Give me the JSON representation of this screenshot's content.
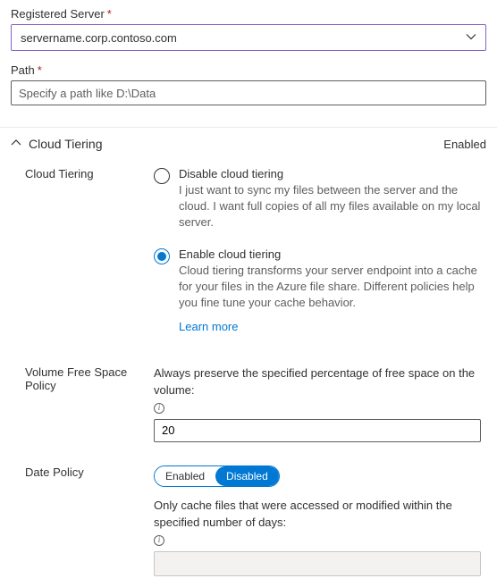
{
  "registeredServer": {
    "label": "Registered Server",
    "required": "*",
    "value": "servername.corp.contoso.com"
  },
  "path": {
    "label": "Path",
    "required": "*",
    "placeholder": "Specify a path like D:\\Data"
  },
  "section": {
    "title": "Cloud Tiering",
    "status": "Enabled"
  },
  "cloudTiering": {
    "label": "Cloud Tiering",
    "disableOption": {
      "title": "Disable cloud tiering",
      "desc": "I just want to sync my files between the server and the cloud. I want full copies of all my files available on my local server."
    },
    "enableOption": {
      "title": "Enable cloud tiering",
      "desc": "Cloud tiering transforms your server endpoint into a cache for your files in the Azure file share. Different policies help you fine tune your cache behavior."
    },
    "learnMore": "Learn more"
  },
  "volumePolicy": {
    "label": "Volume Free Space Policy",
    "desc": "Always preserve the specified percentage of free space on the volume:",
    "value": "20"
  },
  "datePolicy": {
    "label": "Date Policy",
    "toggle": {
      "enabled": "Enabled",
      "disabled": "Disabled"
    },
    "desc": "Only cache files that were accessed or modified within the specified number of days:"
  }
}
